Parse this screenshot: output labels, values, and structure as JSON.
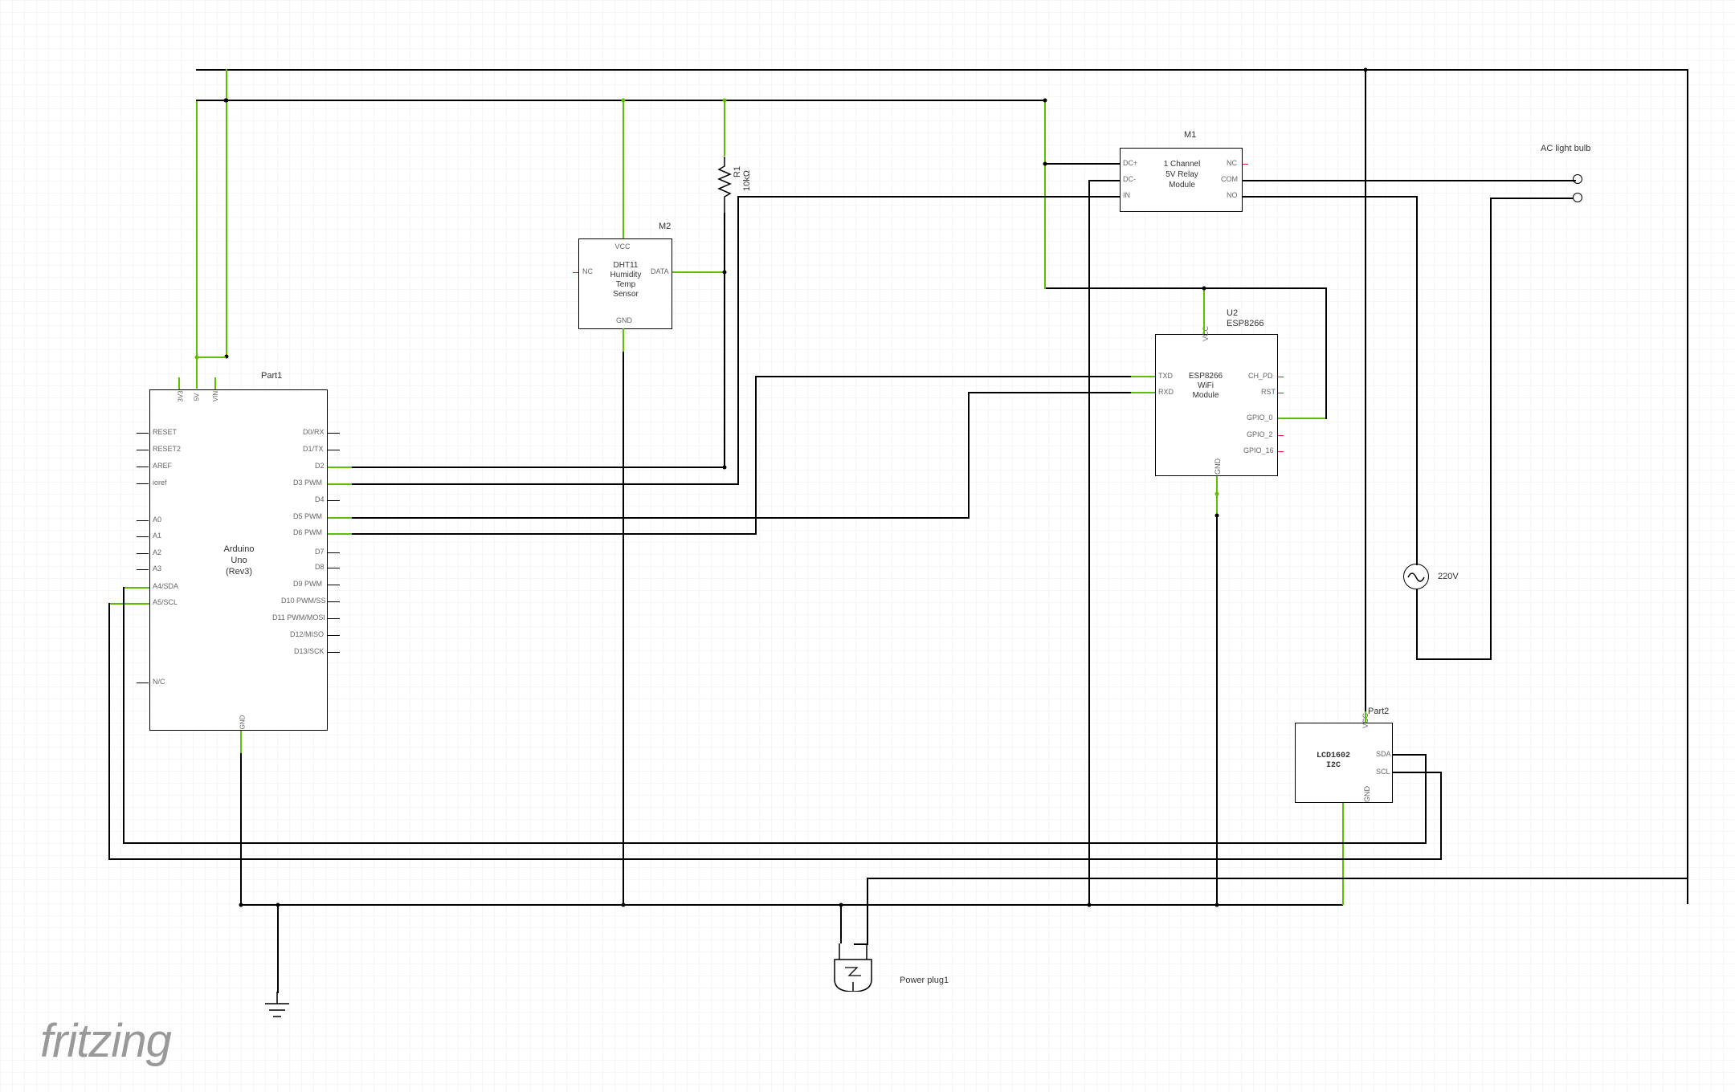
{
  "title": "fritzing",
  "parts": {
    "arduino": {
      "ref": "Part1",
      "name": "Arduino Uno (Rev3)",
      "left": {
        "p3v3": "3V3",
        "p5v": "5V",
        "vin": "VIN",
        "reset": "RESET",
        "reset2": "RESET2",
        "aref": "AREF",
        "ioref": "ioref",
        "a0": "A0",
        "a1": "A1",
        "a2": "A2",
        "a3": "A3",
        "a4": "A4/SDA",
        "a5": "A5/SCL",
        "nc": "N/C"
      },
      "right": {
        "d0": "D0/RX",
        "d1": "D1/TX",
        "d2": "D2",
        "d3": "D3 PWM",
        "d4": "D4",
        "d5": "D5 PWM",
        "d6": "D6 PWM",
        "d7": "D7",
        "d8": "D8",
        "d9": "D9 PWM",
        "d10": "D10 PWM/SS",
        "d11": "D11 PWM/MOSI",
        "d12": "D12/MISO",
        "d13": "D13/SCK"
      },
      "gnd": "GND"
    },
    "dht11": {
      "ref": "M2",
      "name": "DHT11 Humidity Temp Sensor",
      "vcc": "VCC",
      "nc": "NC",
      "data": "DATA",
      "gnd": "GND"
    },
    "r1": {
      "ref": "R1",
      "val": "10kΩ"
    },
    "relay": {
      "ref": "M1",
      "name": "1 Channel 5V Relay Module",
      "dcp": "DC+",
      "dcm": "DC-",
      "in": "IN",
      "nc": "NC",
      "com": "COM",
      "no": "NO"
    },
    "esp": {
      "ref": "U2",
      "sub": "ESP8266",
      "name": "ESP8266 WiFi Module",
      "vcc": "VCC",
      "txd": "TXD",
      "rxd": "RXD",
      "chpd": "CH_PD",
      "rst": "RST",
      "gpio0": "GPIO_0",
      "gpio2": "GPIO_2",
      "gpio16": "GPIO_16",
      "gnd": "GND"
    },
    "lcd": {
      "ref": "Part2",
      "name": "LCD1602 I2C",
      "vcc": "VCC",
      "sda": "SDA",
      "scl": "SCL",
      "gnd": "GND"
    },
    "acsrc": {
      "label": "220V"
    },
    "bulb": {
      "label": "AC light bulb"
    },
    "power": {
      "label": "Power plug1"
    }
  }
}
